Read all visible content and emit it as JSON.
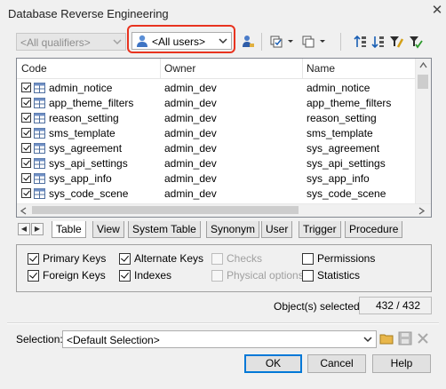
{
  "window": {
    "title": "Database Reverse Engineering"
  },
  "toolbar": {
    "qualifier_placeholder": "<All qualifiers>",
    "users_value": "<All users>"
  },
  "list": {
    "columns": [
      "Code",
      "Owner",
      "Name"
    ],
    "rows": [
      {
        "code": "admin_notice",
        "owner": "admin_dev",
        "name": "admin_notice"
      },
      {
        "code": "app_theme_filters",
        "owner": "admin_dev",
        "name": "app_theme_filters"
      },
      {
        "code": "reason_setting",
        "owner": "admin_dev",
        "name": "reason_setting"
      },
      {
        "code": "sms_template",
        "owner": "admin_dev",
        "name": "sms_template"
      },
      {
        "code": "sys_agreement",
        "owner": "admin_dev",
        "name": "sys_agreement"
      },
      {
        "code": "sys_api_settings",
        "owner": "admin_dev",
        "name": "sys_api_settings"
      },
      {
        "code": "sys_app_info",
        "owner": "admin_dev",
        "name": "sys_app_info"
      },
      {
        "code": "sys_code_scene",
        "owner": "admin_dev",
        "name": "sys_code_scene"
      }
    ]
  },
  "tabs": [
    "Table",
    "View",
    "System Table",
    "Synonym",
    "User",
    "Trigger",
    "Procedure"
  ],
  "options": {
    "primary_keys": "Primary Keys",
    "alternate_keys": "Alternate Keys",
    "checks": "Checks",
    "permissions": "Permissions",
    "foreign_keys": "Foreign Keys",
    "indexes": "Indexes",
    "physical_options": "Physical options",
    "statistics": "Statistics"
  },
  "status": {
    "selected_label": "Object(s) selected:",
    "selected_value": "432 / 432"
  },
  "selection": {
    "label": "Selection:",
    "value": "<Default Selection>"
  },
  "buttons": {
    "ok": "OK",
    "cancel": "Cancel",
    "help": "Help"
  },
  "colors": {
    "highlight_border": "#e8331f",
    "default_button": "#0078d7"
  }
}
